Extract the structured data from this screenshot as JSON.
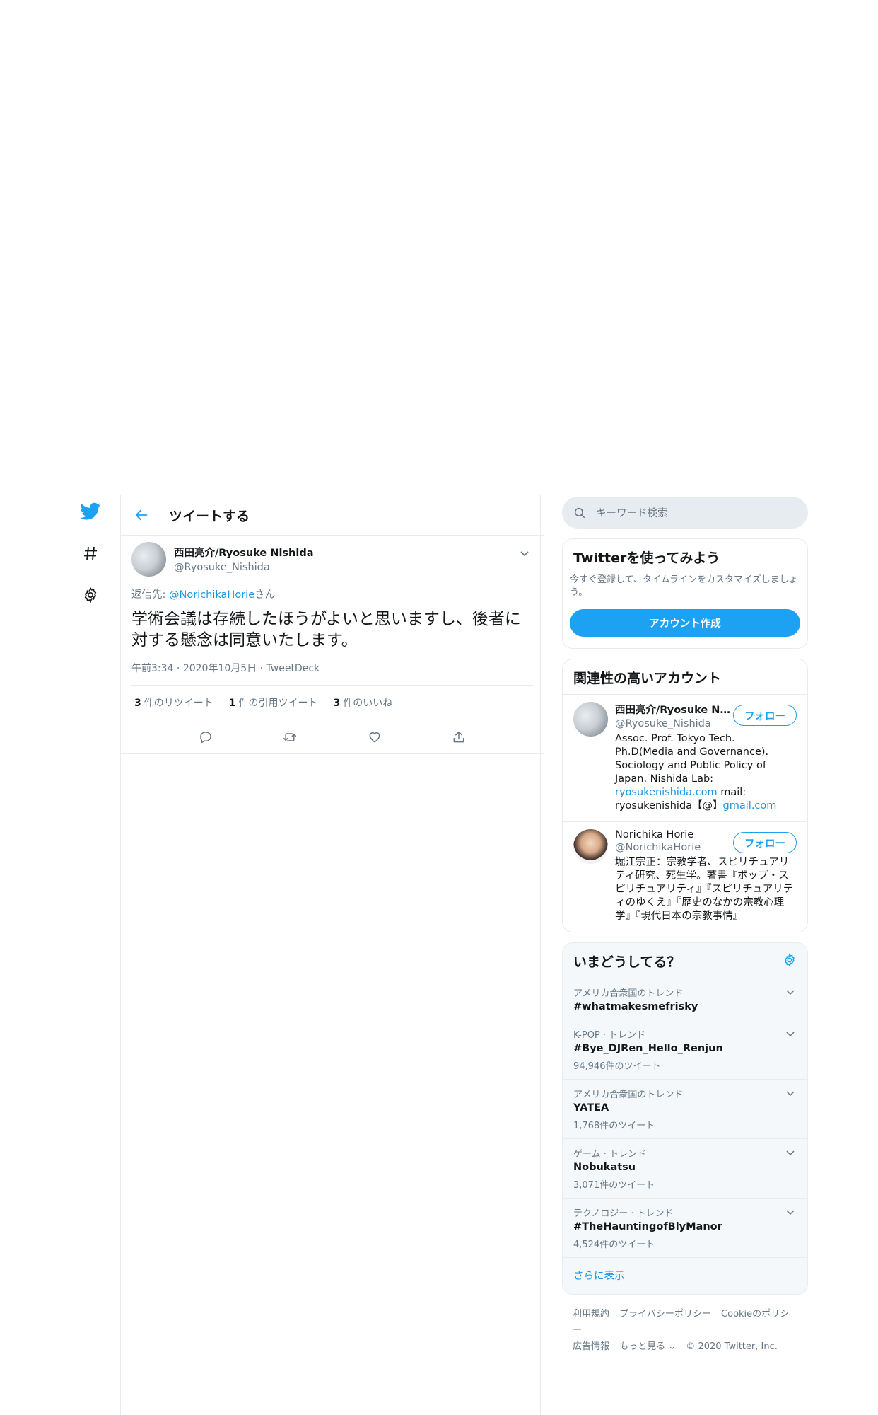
{
  "header": {
    "title": "ツイートする"
  },
  "tweet": {
    "author_name": "西田亮介/Ryosuke Nishida",
    "author_handle": "@Ryosuke_Nishida",
    "reply_prefix": "返信先: ",
    "reply_handle": "@NorichikaHorie",
    "reply_suffix": "さん",
    "text": "学術会議は存続したほうがよいと思いますし、後者に対する懸念は同意いたします。",
    "time": "午前3:34",
    "date": "2020年10月5日",
    "app": "TweetDeck",
    "retweets_count": "3",
    "retweets_label": "件のリツイート",
    "quotes_count": "1",
    "quotes_label": "件の引用ツイート",
    "likes_count": "3",
    "likes_label": "件のいいね"
  },
  "search": {
    "placeholder": "キーワード検索"
  },
  "signup": {
    "title": "Twitterを使ってみよう",
    "description": "今すぐ登録して、タイムラインをカスタマイズしましょう。",
    "button": "アカウント作成"
  },
  "related": {
    "title": "関連性の高いアカウント",
    "accounts": [
      {
        "name": "西田亮介/Ryosuke Ni...",
        "handle": "@Ryosuke_Nishida",
        "bio_text": "Assoc. Prof. Tokyo Tech. Ph.D(Media and Governance). Sociology and Public Policy of Japan. Nishida Lab: ",
        "bio_link": "ryosukenishida.com",
        "bio_text2": " mail: ryosukenishida【@】",
        "bio_link2": "gmail.com",
        "follow": "フォロー"
      },
      {
        "name": "Norichika Horie",
        "handle": "@NorichikaHorie",
        "bio_text": "堀江宗正：宗教学者、スピリチュアリティ研究、死生学。著書『ポップ・スピリチュアリティ』『スピリチュアリティのゆくえ』『歴史のなかの宗教心理学』『現代日本の宗教事情』",
        "follow": "フォロー"
      }
    ]
  },
  "trends": {
    "title": "いまどうしてる？",
    "items": [
      {
        "context": "アメリカ合衆国のトレンド",
        "name": "#whatmakesmefrisky",
        "count": ""
      },
      {
        "context": "K-POP · トレンド",
        "name": "#Bye_DJRen_Hello_Renjun",
        "count": "94,946件のツイート"
      },
      {
        "context": "アメリカ合衆国のトレンド",
        "name": "YATEA",
        "count": "1,768件のツイート"
      },
      {
        "context": "ゲーム · トレンド",
        "name": "Nobukatsu",
        "count": "3,071件のツイート"
      },
      {
        "context": "テクノロジー · トレンド",
        "name": "#TheHauntingofBlyManor",
        "count": "4,524件のツイート"
      }
    ],
    "show_more": "さらに表示"
  },
  "footer": {
    "terms": "利用規約",
    "privacy": "プライバシーポリシー",
    "cookies": "Cookieのポリシー",
    "ads": "広告情報",
    "more": "もっと見る ⌄",
    "copyright": "© 2020 Twitter, Inc."
  },
  "colors": {
    "accent": "#1da1f2",
    "link": "#1b95e0",
    "muted": "#657786",
    "border": "#e6ecf0"
  }
}
